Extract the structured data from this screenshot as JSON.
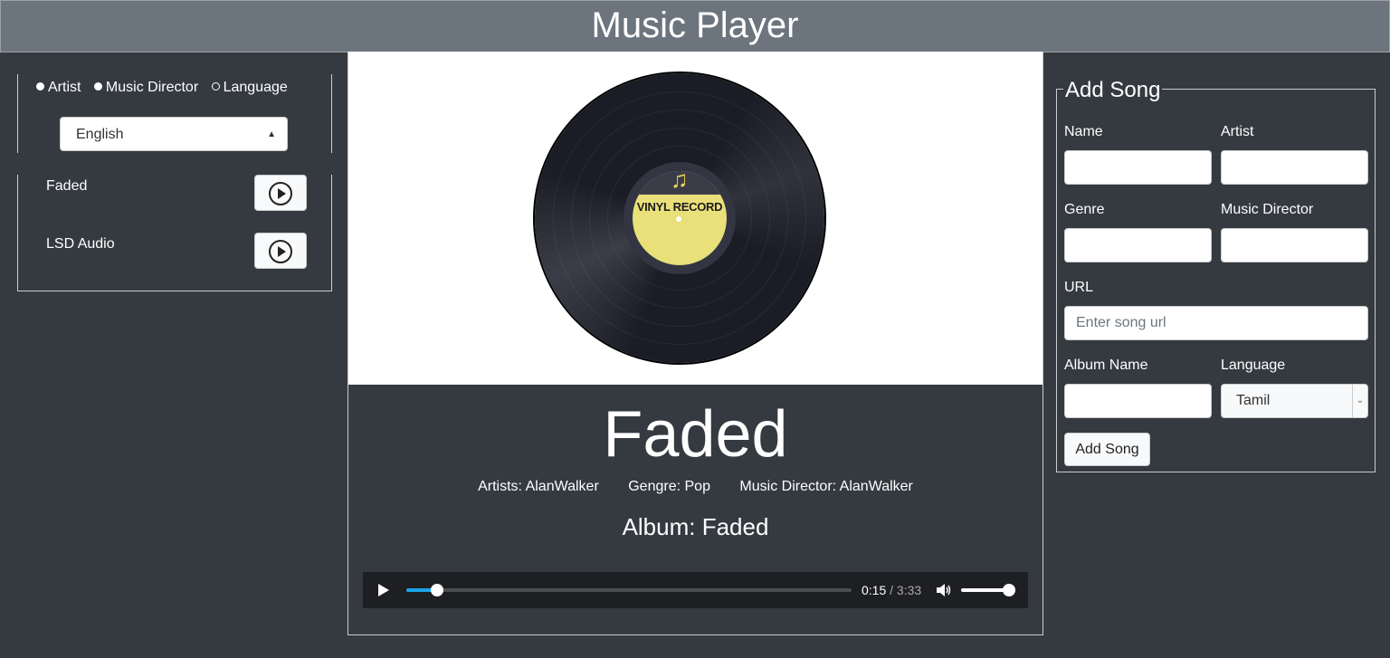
{
  "header": {
    "title": "Music Player"
  },
  "filters": {
    "options": [
      "Artist",
      "Music Director",
      "Language"
    ],
    "selected_language": "English"
  },
  "songs": [
    {
      "name": "Faded"
    },
    {
      "name": "LSD Audio"
    }
  ],
  "now_playing": {
    "title": "Faded",
    "artists": "Artists: AlanWalker",
    "genre": "Gengre: Pop",
    "music_director": "Music Director: AlanWalker",
    "album": "Album: Faded",
    "art_label": "VINYL RECORD",
    "current_time": "0:15",
    "duration": "/ 3:33",
    "progress": 0.07,
    "volume": 1.0
  },
  "form": {
    "legend": "Add Song",
    "labels": {
      "name": "Name",
      "artist": "Artist",
      "genre": "Genre",
      "music_director": "Music Director",
      "url": "URL",
      "album_name": "Album Name",
      "language": "Language"
    },
    "url_placeholder": "Enter song url",
    "language_value": "Tamil",
    "submit_label": "Add Song"
  }
}
